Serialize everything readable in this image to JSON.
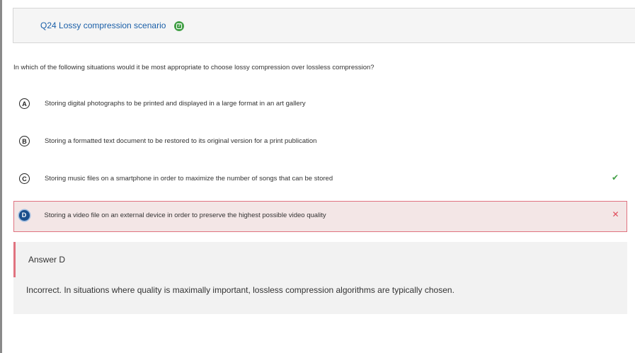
{
  "question": {
    "title": "Q24 Lossy compression scenario",
    "help_icon": "help-icon",
    "prompt": "In which of the following situations would it be most appropriate to choose lossy compression over lossless compression?"
  },
  "options": [
    {
      "letter": "A",
      "text": "Storing digital photographs to be printed and displayed in a large format in an art gallery"
    },
    {
      "letter": "B",
      "text": "Storing a formatted text document to be restored to its original version for a print publication"
    },
    {
      "letter": "C",
      "text": "Storing music files on a smartphone in order to maximize the number of songs that can be stored",
      "mark": "✔"
    },
    {
      "letter": "D",
      "text": "Storing a video file on an external device in order to preserve the highest possible video quality",
      "mark": "✕"
    }
  ],
  "feedback": {
    "answer_label": "Answer D",
    "text": "Incorrect. In situations where quality is maximally important, lossless compression algorithms are typically chosen."
  },
  "colors": {
    "title": "#1a5fa8",
    "correct": "#43a047",
    "incorrect": "#e04a5a",
    "selected": "#1a4f8c"
  }
}
